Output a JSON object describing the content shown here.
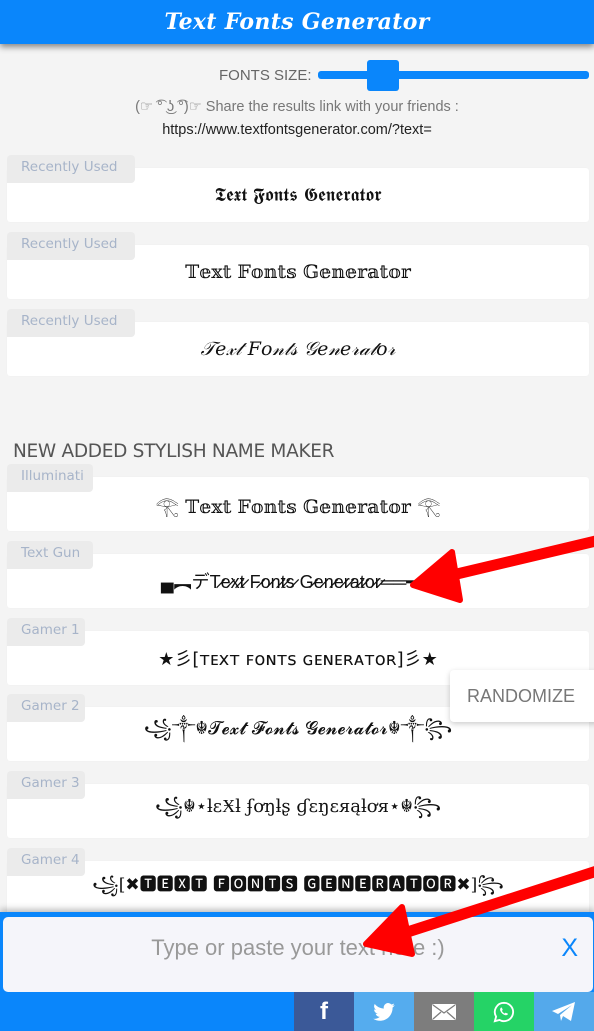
{
  "header": {
    "title": "Text Fonts Generator"
  },
  "font_size": {
    "label": "FONTS SIZE:",
    "value_fraction": 0.24
  },
  "share": {
    "text": "(☞ ͡° ͜ʖ ͡°)☞ Share the results link with your friends :",
    "link": "https://www.textfontsgenerator.com/?text="
  },
  "recent": [
    {
      "label": "Recently Used",
      "text": "𝕿𝖊𝖝𝖙 𝕱𝖔𝖓𝖙𝖘 𝕲𝖊𝖓𝖊𝖗𝖆𝖙𝖔𝖗"
    },
    {
      "label": "Recently Used",
      "text": "𝕋𝕖𝕩𝕥 𝔽𝕠𝕟𝕥𝕤 𝔾𝕖𝕟𝕖𝕣𝕒𝕥𝕠𝕣"
    },
    {
      "label": "Recently Used",
      "text": "𝒯𝑒𝓍𝓉 𝐹𝑜𝓃𝓉𝓈 𝒢𝑒𝓃𝑒𝓇𝒶𝓉𝑜𝓇"
    }
  ],
  "section_title": "NEW ADDED STYLISH NAME MAKER",
  "styles": [
    {
      "label": "Illuminati",
      "text": "𓂀 𝕋𝕖𝕩𝕥 𝔽𝕠𝕟𝕥𝕤 𝔾𝕖𝕟𝕖𝕣𝕒𝕥𝕠𝕣 𓂀"
    },
    {
      "label": "Text Gun",
      "text": "▄︻デT̷e̷x̷t̷ F̷o̷n̷t̷s̷ G̷e̷n̷e̷r̷a̷t̷o̷r̷══━一"
    },
    {
      "label": "Gamer 1",
      "text": "★彡[ᴛᴇxᴛ ꜰᴏɴᴛꜱ ɢᴇɴᴇʀᴀᴛᴏʀ]彡★"
    },
    {
      "label": "Gamer 2",
      "text": "꧁༒☬𝓣𝓮𝔁𝓽 𝓕𝓸𝓷𝓽𝓼 𝓖𝓮𝓷𝓮𝓻𝓪𝓽𝓸𝓻☬༒꧂"
    },
    {
      "label": "Gamer 3",
      "text": "꧁☬⋆ƚεӾƚ ʄơŋƚʂ ɠεŋεяąƚơя⋆☬꧂"
    },
    {
      "label": "Gamer 4",
      "text": "꧁[✖🆃🅴🆇🆃 🅵🅾🅽🆃🆂 🅶🅴🅽🅴🆁🅰🆃🅾🆁✖]꧂"
    }
  ],
  "randomize_label": "RANDOMIZE",
  "input": {
    "placeholder": "Type or paste your text here :)",
    "value": "",
    "clear_label": "X"
  },
  "share_buttons": [
    {
      "name": "facebook",
      "icon": "f",
      "color": "#3b5998"
    },
    {
      "name": "twitter",
      "icon": "🐦",
      "color": "#55acee"
    },
    {
      "name": "email",
      "icon": "✉",
      "color": "#7d7d7d"
    },
    {
      "name": "whatsapp",
      "icon": "☏",
      "color": "#25d366"
    },
    {
      "name": "telegram",
      "icon": "➤",
      "color": "#54a9eb"
    }
  ]
}
